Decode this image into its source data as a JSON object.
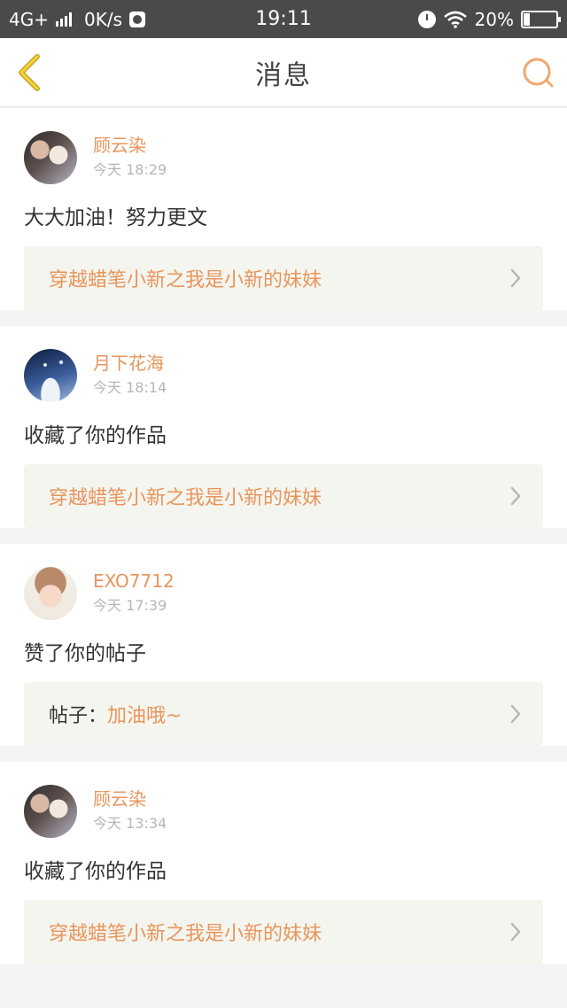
{
  "status_bar": {
    "network": "4G+",
    "speed": "0K/s",
    "time": "19:11",
    "battery": "20%"
  },
  "header": {
    "title": "消息"
  },
  "colors": {
    "accent": "#e8955c",
    "card_link_bg": "#f5f5ef",
    "status_bar_bg": "#4a4a4a"
  },
  "messages": [
    {
      "username": "顾云染",
      "time": "今天 18:29",
      "text": "大大加油！努力更文",
      "link_prefix": "",
      "link_title": "穿越蜡笔小新之我是小新的妹妹"
    },
    {
      "username": "月下花海",
      "time": "今天 18:14",
      "text": "收藏了你的作品",
      "link_prefix": "",
      "link_title": "穿越蜡笔小新之我是小新的妹妹"
    },
    {
      "username": "EXO7712",
      "time": "今天 17:39",
      "text": "赞了你的帖子",
      "link_prefix": "帖子：",
      "link_title": "加油哦~"
    },
    {
      "username": "顾云染",
      "time": "今天 13:34",
      "text": "收藏了你的作品",
      "link_prefix": "",
      "link_title": "穿越蜡笔小新之我是小新的妹妹"
    }
  ]
}
